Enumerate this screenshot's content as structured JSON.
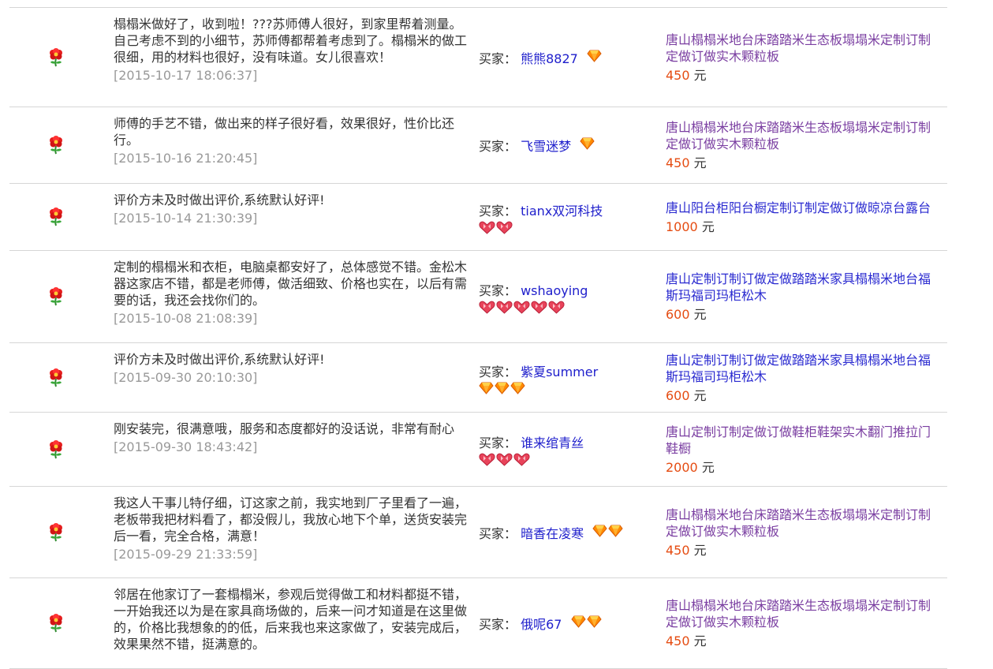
{
  "reviews": [
    {
      "text": "榻榻米做好了，收到啦！???苏师傅人很好，到家里帮着测量。自己考虑不到的小细节，苏师傅都帮着考虑到了。榻榻米的做工很细，用的材料也很好，没有味道。女儿很喜欢！",
      "date": "[2015-10-17 18:06:37]",
      "buyer_label": "买家：",
      "buyer": "熊熊8827",
      "badge": "diamond",
      "badge_count": 1,
      "item": "唐山榻榻米地台床踏踏米生态板塌塌米定制订制定做订做实木颗粒板",
      "price": "450",
      "unit": "元"
    },
    {
      "text": "师傅的手艺不错，做出来的样子很好看，效果很好，性价比还行。",
      "date": "[2015-10-16 21:20:45]",
      "buyer_label": "买家：",
      "buyer": "飞雪迷梦",
      "badge": "diamond",
      "badge_count": 1,
      "item": "唐山榻榻米地台床踏踏米生态板塌塌米定制订制定做订做实木颗粒板",
      "price": "450",
      "unit": "元"
    },
    {
      "text": "评价方未及时做出评价,系统默认好评!",
      "date": "[2015-10-14 21:30:39]",
      "buyer_label": "买家：",
      "buyer": "tianx双河科技",
      "badge": "heart",
      "badge_count": 2,
      "item": "唐山阳台柜阳台橱定制订制定做订做晾凉台露台",
      "price": "1000",
      "unit": "元"
    },
    {
      "text": "定制的榻榻米和衣柜，电脑桌都安好了，总体感觉不错。金松木器这家店不错，都是老师傅，做活细致、价格也实在，以后有需要的话，我还会找你们的。",
      "date": "[2015-10-08 21:08:39]",
      "buyer_label": "买家：",
      "buyer": "wshaoying",
      "badge": "heart",
      "badge_count": 5,
      "item": "唐山定制订制订做定做踏踏米家具榻榻米地台福斯玛福司玛柜松木",
      "price": "600",
      "unit": "元"
    },
    {
      "text": "评价方未及时做出评价,系统默认好评!",
      "date": "[2015-09-30 20:10:30]",
      "buyer_label": "买家：",
      "buyer": "紫夏summer",
      "badge": "diamond",
      "badge_count": 3,
      "item": "唐山定制订制订做定做踏踏米家具榻榻米地台福斯玛福司玛柜松木",
      "price": "600",
      "unit": "元"
    },
    {
      "text": "刚安装完，很满意哦，服务和态度都好的没话说，非常有耐心",
      "date": "[2015-09-30 18:43:42]",
      "buyer_label": "买家：",
      "buyer": "谁来绾青丝",
      "badge": "heart",
      "badge_count": 3,
      "item": "唐山定制订制定做订做鞋柜鞋架实木翻门推拉门鞋橱",
      "price": "2000",
      "unit": "元"
    },
    {
      "text": "我这人干事儿特仔细，订这家之前，我实地到厂子里看了一遍，老板带我把材料看了，都没假儿，我放心地下个单，送货安装完后一看，完全合格，满意！",
      "date": "[2015-09-29 21:33:59]",
      "buyer_label": "买家：",
      "buyer": "暗香在凌寒",
      "badge": "diamond",
      "badge_count": 2,
      "item": "唐山榻榻米地台床踏踏米生态板塌塌米定制订制定做订做实木颗粒板",
      "price": "450",
      "unit": "元"
    },
    {
      "text": "邻居在他家订了一套榻榻米，参观后觉得做工和材料都挺不错，一开始我还以为是在家具商场做的，后来一问才知道是在这里做的，价格比我想象的的低，后来我也来这家做了，安装完成后，效果果然不错，挺满意的。",
      "date": "",
      "buyer_label": "买家：",
      "buyer": "俄呢67",
      "badge": "diamond",
      "badge_count": 2,
      "item": "唐山榻榻米地台床踏踏米生态板塌塌米定制订制定做订做实木颗粒板",
      "price": "450",
      "unit": "元"
    }
  ],
  "colors": {
    "buyer_link": "#2020cc",
    "item_link_purple": "#7a3ea1",
    "item_link_blue": "#2a2ad0",
    "price": "#e54c12",
    "date": "#999999",
    "divider": "#d6d6d6"
  },
  "icons": {
    "row_icon": "red-flower-icon",
    "diamond": "diamond-icon",
    "heart": "heart-icon"
  }
}
